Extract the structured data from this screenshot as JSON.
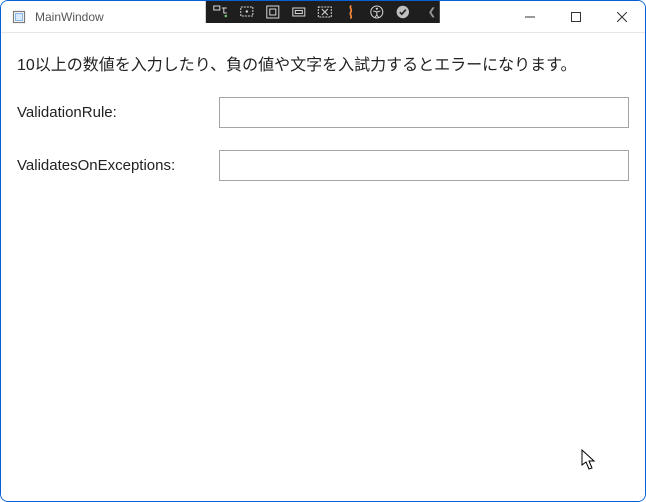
{
  "window": {
    "title": "MainWindow"
  },
  "content": {
    "description": "10以上の数値を入力したり、負の値や文字を入試力するとエラーになります。",
    "fields": [
      {
        "label": "ValidationRule:",
        "value": ""
      },
      {
        "label": "ValidatesOnExceptions:",
        "value": ""
      }
    ]
  },
  "debug_toolbar": {
    "items": [
      "live-visual-tree-icon",
      "select-element-icon",
      "display-layout-icon",
      "track-focused-icon",
      "binding-failures-icon",
      "hot-reload-icon",
      "accessibility-icon",
      "status-ok-icon"
    ]
  }
}
